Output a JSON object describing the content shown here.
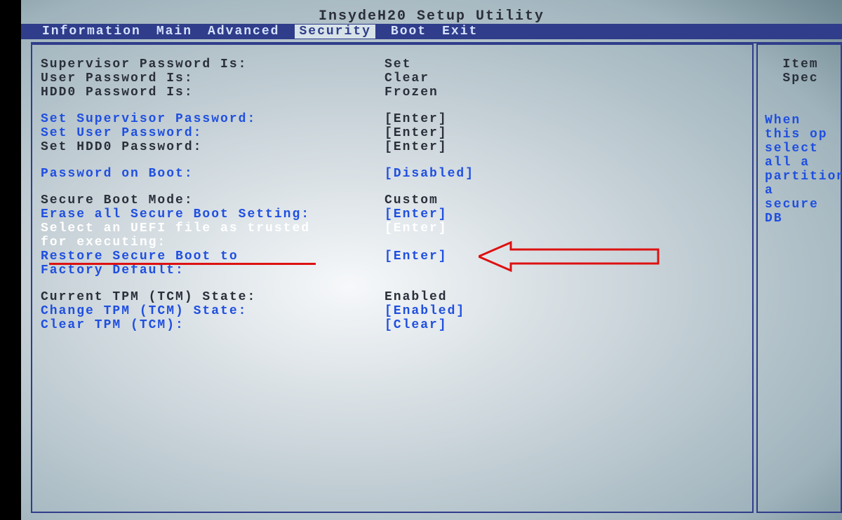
{
  "title": "InsydeH20 Setup Utility",
  "menu": {
    "information": "Information",
    "main": "Main",
    "advanced": "Advanced",
    "security": "Security",
    "boot": "Boot",
    "exit": "Exit"
  },
  "rows": {
    "supervisor_pw_is": {
      "label": "Supervisor Password Is:",
      "value": "Set"
    },
    "user_pw_is": {
      "label": "User Password Is:",
      "value": "Clear"
    },
    "hdd0_pw_is": {
      "label": "HDD0 Password Is:",
      "value": "Frozen"
    },
    "set_supervisor_pw": {
      "label": "Set Supervisor Password:",
      "value": "[Enter]"
    },
    "set_user_pw": {
      "label": "Set User Password:",
      "value": "[Enter]"
    },
    "set_hdd0_pw": {
      "label": "Set HDD0 Password:",
      "value": "[Enter]"
    },
    "pw_on_boot": {
      "label": "Password on Boot:",
      "value": "[Disabled]"
    },
    "secure_boot_mode": {
      "label": "Secure Boot Mode:",
      "value": "Custom"
    },
    "erase_secure_boot": {
      "label": "Erase all Secure Boot Setting:",
      "value": "[Enter]"
    },
    "select_uefi_l1": {
      "label": "Select an UEFI file as trusted",
      "value": "[Enter]"
    },
    "select_uefi_l2": {
      "label": "for executing:",
      "value": ""
    },
    "restore_secure_l1": {
      "label": "Restore Secure Boot to",
      "value": "[Enter]"
    },
    "restore_secure_l2": {
      "label": "Factory Default:",
      "value": ""
    },
    "current_tpm": {
      "label": "Current TPM (TCM) State:",
      "value": "Enabled"
    },
    "change_tpm": {
      "label": "Change TPM (TCM) State:",
      "value": "[Enabled]"
    },
    "clear_tpm": {
      "label": "Clear TPM (TCM):",
      "value": "[Clear]"
    }
  },
  "help": {
    "heading": "Item Spec",
    "l1": "When this op",
    "l2": "select all a",
    "l3": "partitions a",
    "l4": "secure DB"
  }
}
